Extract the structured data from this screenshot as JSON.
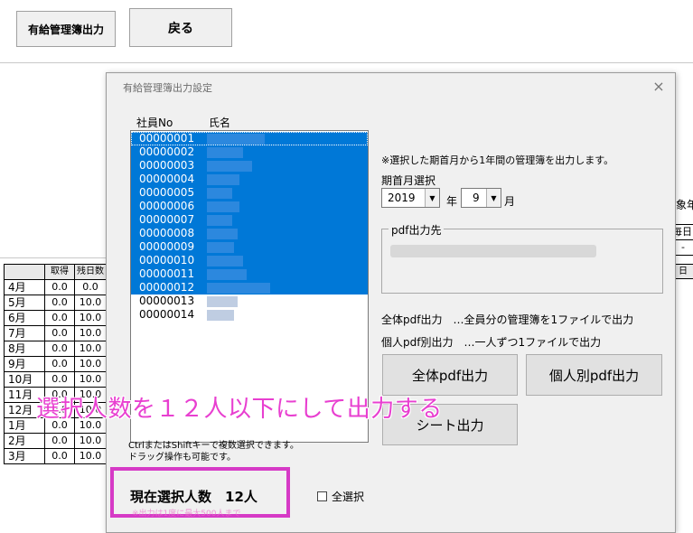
{
  "sheet": {
    "output_button": "有給管理簿出力",
    "back_button": "戻る",
    "col_taken": "取得",
    "col_remaining": "残日数",
    "months": [
      {
        "label": "4月",
        "taken": "0.0",
        "remain": "0.0"
      },
      {
        "label": "5月",
        "taken": "0.0",
        "remain": "10.0"
      },
      {
        "label": "6月",
        "taken": "0.0",
        "remain": "10.0"
      },
      {
        "label": "7月",
        "taken": "0.0",
        "remain": "10.0"
      },
      {
        "label": "8月",
        "taken": "0.0",
        "remain": "10.0"
      },
      {
        "label": "9月",
        "taken": "0.0",
        "remain": "10.0"
      },
      {
        "label": "10月",
        "taken": "0.0",
        "remain": "10.0"
      },
      {
        "label": "11月",
        "taken": "0.0",
        "remain": "10.0"
      },
      {
        "label": "12月",
        "taken": "0.0",
        "remain": "10.0"
      },
      {
        "label": "1月",
        "taken": "0.0",
        "remain": "10.0"
      },
      {
        "label": "2月",
        "taken": "0.0",
        "remain": "10.0"
      },
      {
        "label": "3月",
        "taken": "0.0",
        "remain": "10.0"
      }
    ],
    "right_text_1": "象年",
    "right_text_2": "毎日",
    "right_text_3": "日",
    "right_text_4": "-"
  },
  "dialog": {
    "title": "有給管理簿出力設定",
    "close": "×",
    "col_empno": "社員No",
    "col_name": "氏名",
    "employees": [
      {
        "no": "00000001",
        "selected": true
      },
      {
        "no": "00000002",
        "selected": true
      },
      {
        "no": "00000003",
        "selected": true
      },
      {
        "no": "00000004",
        "selected": true
      },
      {
        "no": "00000005",
        "selected": true
      },
      {
        "no": "00000006",
        "selected": true
      },
      {
        "no": "00000007",
        "selected": true
      },
      {
        "no": "00000008",
        "selected": true
      },
      {
        "no": "00000009",
        "selected": true
      },
      {
        "no": "00000010",
        "selected": true
      },
      {
        "no": "00000011",
        "selected": true
      },
      {
        "no": "00000012",
        "selected": true
      },
      {
        "no": "00000013",
        "selected": false
      },
      {
        "no": "00000014",
        "selected": false
      }
    ],
    "period_note": "※選択した期首月から1年間の管理簿を出力します。",
    "period_label": "期首月選択",
    "year_value": "2019",
    "year_unit": "年",
    "month_value": "9",
    "month_unit": "月",
    "pdf_dest_label": "pdf出力先",
    "desc_all": "全体pdf出力　…全員分の管理簿を1ファイルで出力",
    "desc_each": "個人pdf別出力　…一人ずつ1ファイルで出力",
    "btn_all_pdf": "全体pdf出力",
    "btn_each_pdf": "個人別pdf出力",
    "btn_sheet": "シート出力",
    "hint_1": "CtrlまたはShiftキーで複数選択できます。",
    "hint_2": "ドラッグ操作も可能です。",
    "count_text": "現在選択人数　12人",
    "count_sub": "※出力は1度に最大500人まで",
    "select_all": "全選択"
  },
  "annotation": "選択人数を１２人以下にして出力する",
  "colors": {
    "selection": "#0078d7",
    "annotation": "#e83fd0",
    "highlight_border": "#d63ac6"
  }
}
